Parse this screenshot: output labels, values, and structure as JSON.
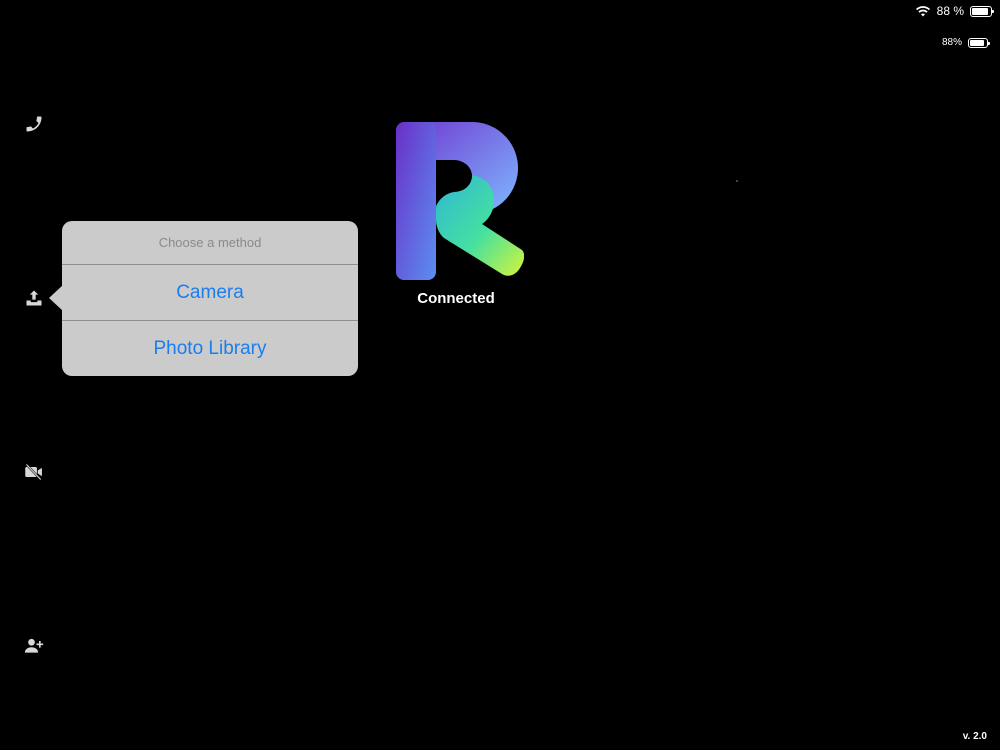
{
  "status_bar": {
    "battery_text": "88 %",
    "battery_level": 0.88,
    "icons": [
      "wifi-icon",
      "battery-icon"
    ]
  },
  "device_battery": {
    "text": "88%",
    "level": 0.88
  },
  "rail": {
    "icons": [
      "phone-icon",
      "upload-icon",
      "video-off-icon",
      "add-user-icon"
    ]
  },
  "connection": {
    "status": "Connected"
  },
  "popover": {
    "title": "Choose a method",
    "options": [
      "Camera",
      "Photo Library"
    ],
    "option_color": "#1a7df0"
  },
  "brand": {
    "gradient": [
      "#6a2fc9",
      "#4f7ff0",
      "#3fd6b0",
      "#c8f03a"
    ]
  },
  "footer": {
    "version": "v. 2.0"
  }
}
